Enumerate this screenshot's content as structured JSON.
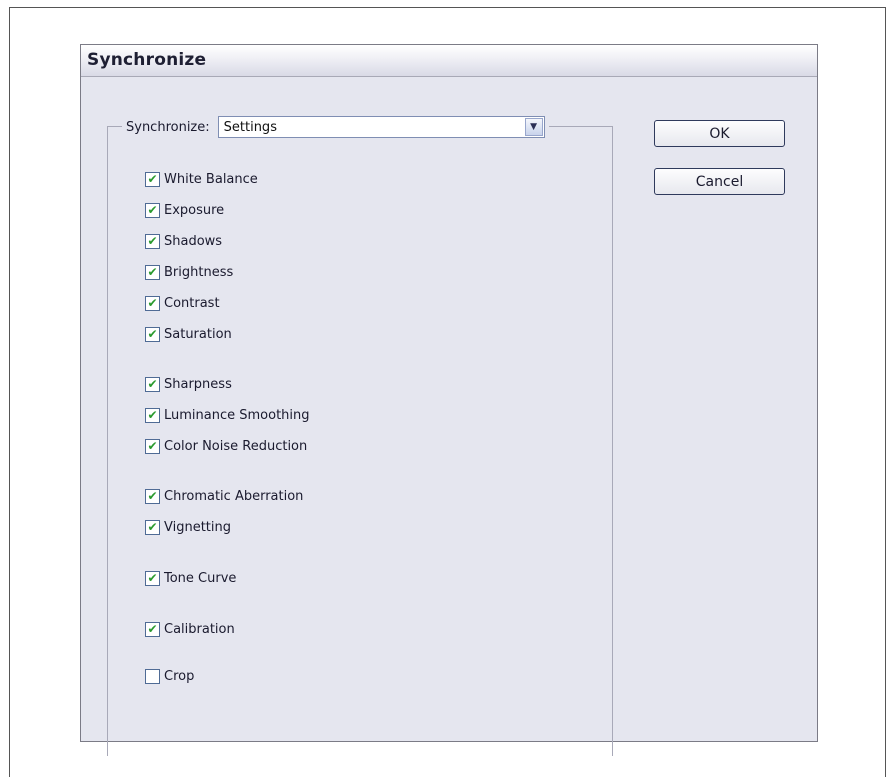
{
  "dialog": {
    "title": "Synchronize",
    "synchronize_label": "Synchronize:",
    "synchronize_value": "Settings",
    "ok_label": "OK",
    "cancel_label": "Cancel"
  },
  "options": [
    {
      "label": "White Balance",
      "checked": true
    },
    {
      "label": "Exposure",
      "checked": true
    },
    {
      "label": "Shadows",
      "checked": true
    },
    {
      "label": "Brightness",
      "checked": true
    },
    {
      "label": "Contrast",
      "checked": true
    },
    {
      "label": "Saturation",
      "checked": true
    },
    {
      "label": "Sharpness",
      "checked": true
    },
    {
      "label": "Luminance Smoothing",
      "checked": true
    },
    {
      "label": "Color Noise Reduction",
      "checked": true
    },
    {
      "label": "Chromatic Aberration",
      "checked": true
    },
    {
      "label": "Vignetting",
      "checked": true
    },
    {
      "label": "Tone Curve",
      "checked": true
    },
    {
      "label": "Calibration",
      "checked": true
    },
    {
      "label": "Crop",
      "checked": false
    }
  ],
  "icons": {
    "check": "checkmark-icon",
    "dropdown": "chevron-down-icon"
  },
  "colors": {
    "dialog_bg": "#e5e6ef",
    "check_color": "#2a9a2e"
  }
}
